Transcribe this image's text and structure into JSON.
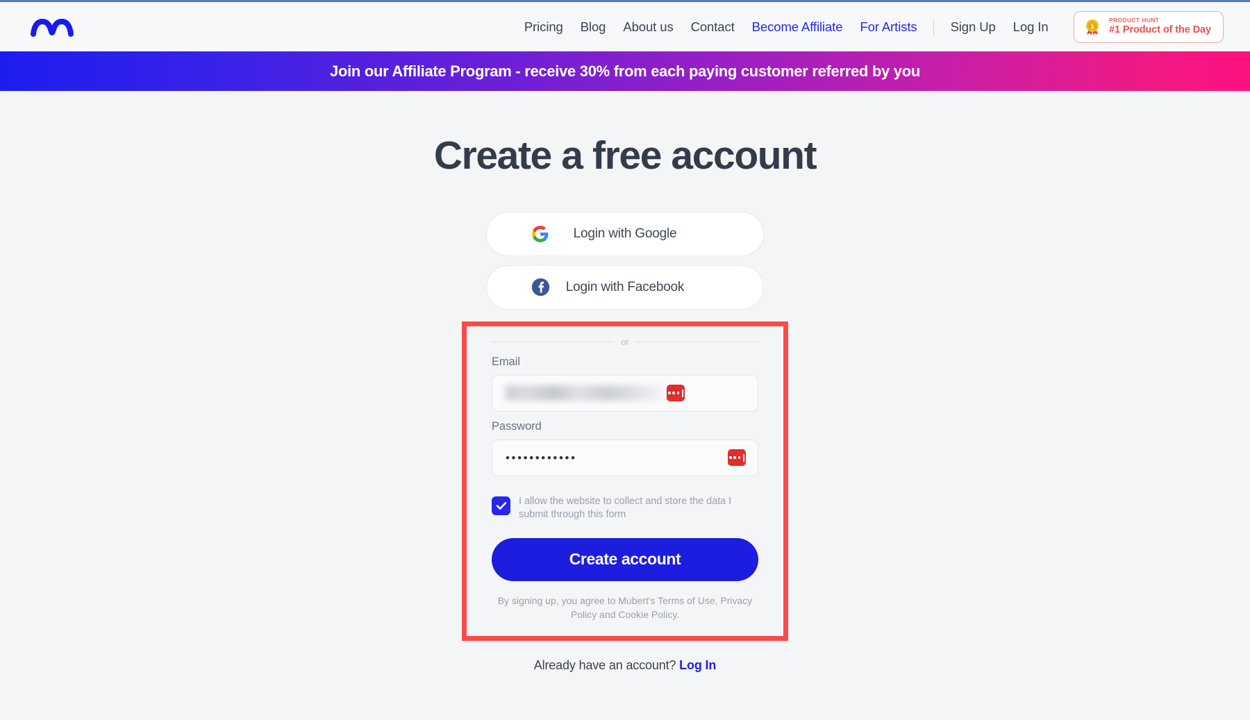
{
  "header": {
    "logo_name": "mubert-wave-logo",
    "nav": [
      {
        "label": "Pricing",
        "accent": false
      },
      {
        "label": "Blog",
        "accent": false
      },
      {
        "label": "About us",
        "accent": false
      },
      {
        "label": "Contact",
        "accent": false
      },
      {
        "label": "Become Affiliate",
        "accent": true
      },
      {
        "label": "For Artists",
        "accent": true
      }
    ],
    "auth": [
      {
        "label": "Sign Up"
      },
      {
        "label": "Log In"
      }
    ],
    "product_hunt": {
      "kicker": "PRODUCT HUNT",
      "title": "#1 Product of the Day",
      "icon": "medal-icon"
    }
  },
  "banner": {
    "text": "Join our Affiliate Program - receive 30% from each paying customer referred by you",
    "gradient_start": "#1d1df0",
    "gradient_end": "#ff1180"
  },
  "main": {
    "title": "Create a free account",
    "social_buttons": [
      {
        "label": "Login with Google",
        "icon": "google-icon"
      },
      {
        "label": "Login with Facebook",
        "icon": "facebook-icon"
      }
    ],
    "divider_text": "or",
    "email_field": {
      "label": "Email",
      "value": "",
      "redacted": true,
      "manager_icon": "password-manager-icon"
    },
    "password_field": {
      "label": "Password",
      "value": "••••••••••••",
      "manager_icon": "password-manager-icon"
    },
    "consent": {
      "checked": true,
      "text": "I allow the website to collect and store the data I submit through this form"
    },
    "submit_label": "Create account",
    "terms_text": "By signing up, you agree to Mubert's Terms of Use, Privacy Policy and Cookie Policy.",
    "footer": {
      "text": "Already have an account?",
      "link": "Log In"
    }
  },
  "annotation": {
    "highlight_color": "#fb4a4a",
    "name": "signup-form-highlight"
  },
  "colors": {
    "brand_blue": "#1d1de0",
    "accent_link": "#2626ef",
    "text_dark": "#343c4a",
    "muted": "#9aa0ab"
  }
}
